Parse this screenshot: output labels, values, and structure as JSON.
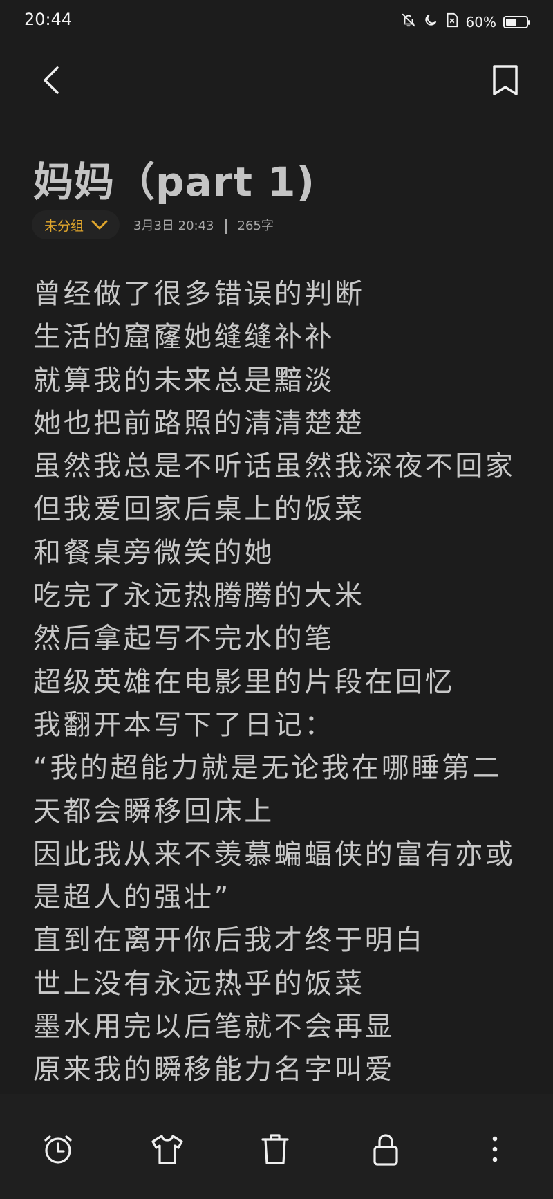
{
  "status_bar": {
    "time": "20:44",
    "battery_text": "60%",
    "battery_level": 0.6,
    "icons": [
      "bell-off-icon",
      "moon-icon",
      "sim-off-icon",
      "battery-icon"
    ]
  },
  "header": {
    "back_icon": "chevron-left-icon",
    "bookmark_icon": "bookmark-icon"
  },
  "note": {
    "title": "妈妈（part 1)",
    "group_label": "未分组",
    "date": "3月3日 20:43",
    "word_count": "265字",
    "lines": [
      "曾经做了很多错误的判断",
      "生活的窟窿她缝缝补补",
      "就算我的未来总是黯淡",
      "她也把前路照的清清楚楚",
      "虽然我总是不听话虽然我深夜不回家",
      "但我爱回家后桌上的饭菜",
      "和餐桌旁微笑的她",
      "吃完了永远热腾腾的大米",
      "然后拿起写不完水的笔",
      "超级英雄在电影里的片段在回忆",
      "我翻开本写下了日记：",
      "“我的超能力就是无论我在哪睡第二",
      "天都会瞬移回床上",
      "因此我从来不羡慕蝙蝠侠的富有亦或",
      "是超人的强壮”",
      "直到在离开你后我才终于明白",
      "世上没有永远热乎的饭菜",
      "墨水用完以后笔就不会再显",
      "原来我的瞬移能力名字叫爱"
    ]
  },
  "bottom_bar": {
    "icons": [
      "alarm-clock-icon",
      "t-shirt-icon",
      "trash-icon",
      "lock-icon",
      "more-vertical-icon"
    ]
  },
  "colors": {
    "background": "#1c1c1c",
    "accent": "#e0a62c",
    "text": "#c8c8c8",
    "meta": "#a8a8a8"
  }
}
